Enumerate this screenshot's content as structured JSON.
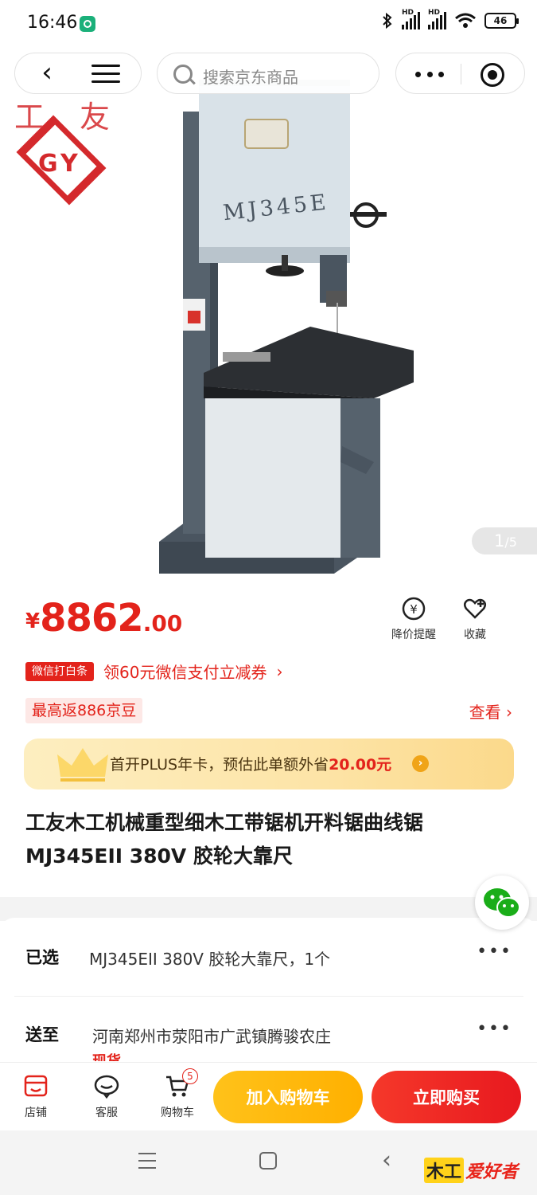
{
  "status_bar": {
    "time": "16:46",
    "battery": "46",
    "signal_tag_1": "HD",
    "signal_tag_2": "HD"
  },
  "nav": {
    "search_placeholder": "搜索京东商品"
  },
  "logo": {
    "char_left": "工",
    "char_right": "友",
    "mark": "GY"
  },
  "product_image": {
    "model_label": "MJ345E"
  },
  "gallery": {
    "current": "1",
    "total": "/5"
  },
  "price": {
    "currency": "¥",
    "integer": "8862",
    "decimal": ".00"
  },
  "actions": {
    "price_drop": "降价提醒",
    "favorite": "收藏"
  },
  "wechat_promo": {
    "tag": "微信打白条",
    "text": "领60元微信支付立减券",
    "arrow": "›"
  },
  "jd_beans": {
    "tag": "最高返886京豆",
    "link": "查看 ›"
  },
  "plus": {
    "text_prefix": "首开PLUS年卡，预估此单额外省",
    "amount": "20.00元",
    "arrow": "›"
  },
  "product": {
    "title": "工友木工机械重型细木工带锯机开料锯曲线锯MJ345EII 380V 胶轮大靠尺"
  },
  "selected": {
    "label": "已选",
    "value": "MJ345EII 380V 胶轮大靠尺，1个",
    "more": "•••"
  },
  "shipping": {
    "label": "送至",
    "value": "河南郑州市荥阳市广武镇腾骏农庄",
    "note": "现货",
    "more": "•••"
  },
  "bottom_bar": {
    "store": "店铺",
    "service": "客服",
    "cart": "购物车",
    "cart_count": "5",
    "add_to_cart": "加入购物车",
    "buy_now": "立即购买"
  },
  "watermark": {
    "prefix": "木工",
    "text": "爱好者"
  },
  "colors": {
    "accent_red": "#e3231b",
    "cart_yellow": "#ffb000",
    "plus_gold": "#fde4a7"
  }
}
